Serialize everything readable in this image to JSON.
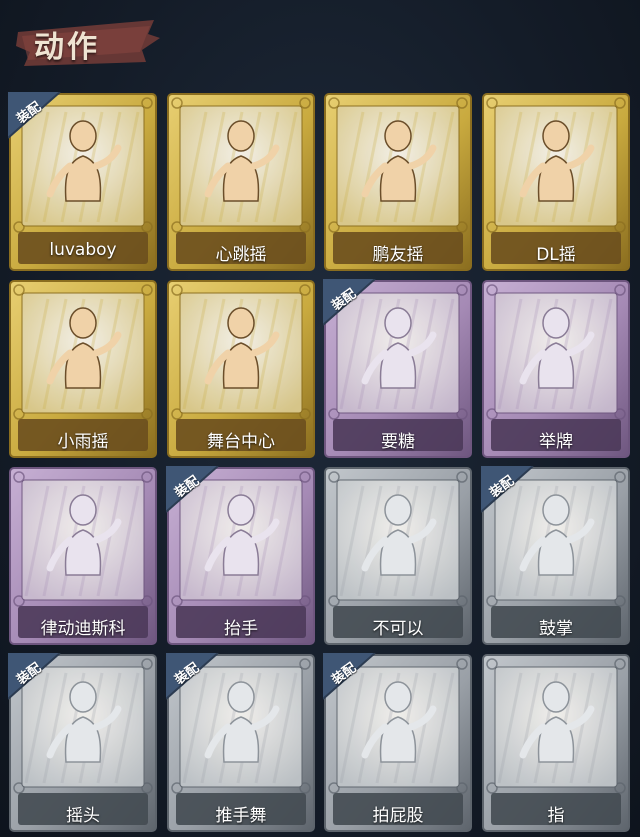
{
  "header": {
    "title": "动作"
  },
  "badge_text": "装配",
  "colors": {
    "gold": "#cdae43",
    "purple": "#a886b8",
    "gray": "#9aa1a8",
    "badge": "#3f5675"
  },
  "cards": [
    {
      "label": "luvaboy",
      "tier": "gold",
      "equipped": true,
      "icon": "dance-figure-icon"
    },
    {
      "label": "心跳摇",
      "tier": "gold",
      "equipped": false,
      "icon": "heartbeat-dance-icon"
    },
    {
      "label": "鹏友摇",
      "tier": "gold",
      "equipped": false,
      "icon": "friend-dance-icon"
    },
    {
      "label": "DL摇",
      "tier": "gold",
      "equipped": false,
      "icon": "dl-dance-icon"
    },
    {
      "label": "小雨摇",
      "tier": "gold",
      "equipped": false,
      "icon": "rain-dance-icon"
    },
    {
      "label": "舞台中心",
      "tier": "gold",
      "equipped": false,
      "icon": "stage-center-icon"
    },
    {
      "label": "要糖",
      "tier": "purple",
      "equipped": true,
      "icon": "ask-candy-icon"
    },
    {
      "label": "举牌",
      "tier": "purple",
      "equipped": false,
      "icon": "hold-sign-icon"
    },
    {
      "label": "律动迪斯科",
      "tier": "purple",
      "equipped": false,
      "icon": "disco-icon"
    },
    {
      "label": "抬手",
      "tier": "purple",
      "equipped": true,
      "icon": "raise-hand-icon"
    },
    {
      "label": "不可以",
      "tier": "gray",
      "equipped": false,
      "icon": "finger-wag-icon"
    },
    {
      "label": "鼓掌",
      "tier": "gray",
      "equipped": true,
      "icon": "clap-icon"
    },
    {
      "label": "摇头",
      "tier": "gray",
      "equipped": true,
      "icon": "head-shake-icon"
    },
    {
      "label": "推手舞",
      "tier": "gray",
      "equipped": true,
      "icon": "push-hand-dance-icon"
    },
    {
      "label": "拍屁股",
      "tier": "gray",
      "equipped": true,
      "icon": "pat-butt-icon"
    },
    {
      "label": "指",
      "tier": "gray",
      "equipped": false,
      "icon": "point-icon"
    }
  ]
}
